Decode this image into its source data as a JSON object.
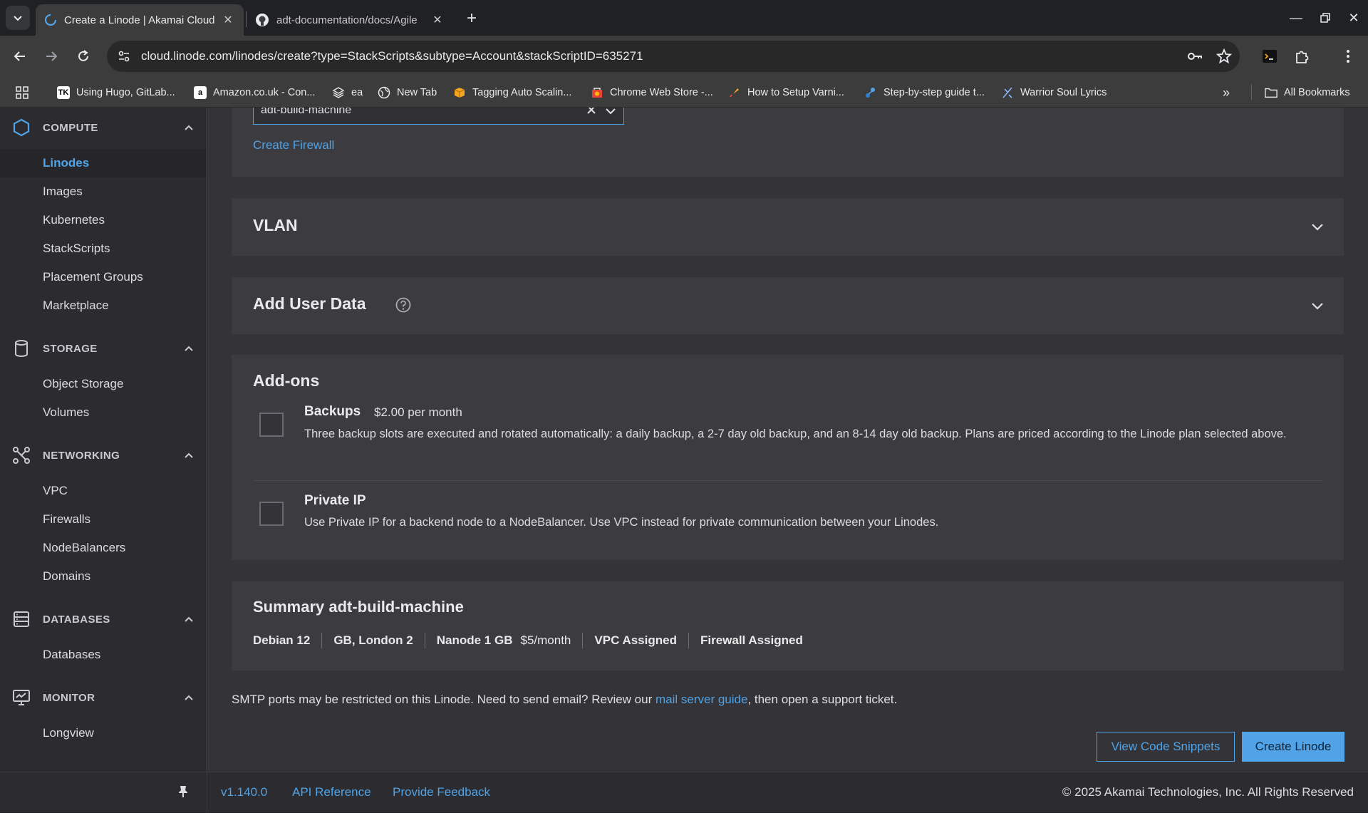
{
  "browser": {
    "tabs": [
      {
        "title": "Create a Linode | Akamai Cloud"
      },
      {
        "title": "adt-documentation/docs/Agile"
      }
    ],
    "url": "cloud.linode.com/linodes/create?type=StackScripts&subtype=Account&stackScriptID=635271",
    "bookmarks": [
      {
        "label": "Using Hugo, GitLab..."
      },
      {
        "label": "Amazon.co.uk - Con..."
      },
      {
        "label": "ea"
      },
      {
        "label": "New Tab"
      },
      {
        "label": "Tagging Auto Scalin..."
      },
      {
        "label": "Chrome Web Store -..."
      },
      {
        "label": "How to Setup Varni..."
      },
      {
        "label": "Step-by-step guide t..."
      },
      {
        "label": "Warrior Soul Lyrics"
      }
    ],
    "all_bookmarks": "All Bookmarks",
    "tk_badge": "TK",
    "amazon_badge": "a"
  },
  "sidebar": {
    "compute": {
      "label": "COMPUTE",
      "items": [
        "Linodes",
        "Images",
        "Kubernetes",
        "StackScripts",
        "Placement Groups",
        "Marketplace"
      ]
    },
    "storage": {
      "label": "STORAGE",
      "items": [
        "Object Storage",
        "Volumes"
      ]
    },
    "networking": {
      "label": "NETWORKING",
      "items": [
        "VPC",
        "Firewalls",
        "NodeBalancers",
        "Domains"
      ]
    },
    "databases": {
      "label": "DATABASES",
      "items": [
        "Databases"
      ]
    },
    "monitor": {
      "label": "MONITOR",
      "items": [
        "Longview"
      ]
    }
  },
  "firewall": {
    "selected": "adt-build-machine",
    "create_link": "Create Firewall"
  },
  "vlan": {
    "title": "VLAN"
  },
  "user_data": {
    "title": "Add User Data"
  },
  "addons": {
    "title": "Add-ons",
    "backups": {
      "title": "Backups",
      "price": "$2.00 per month",
      "description": "Three backup slots are executed and rotated automatically: a daily backup, a 2-7 day old backup, and an 8-14 day old backup. Plans are priced according to the Linode plan selected above.",
      "checked": false
    },
    "private_ip": {
      "title": "Private IP",
      "description": "Use Private IP for a backend node to a NodeBalancer. Use VPC instead for private communication between your Linodes.",
      "checked": false
    }
  },
  "summary": {
    "title": "Summary adt-build-machine",
    "image": "Debian 12",
    "region": "GB, London 2",
    "plan": "Nanode 1 GB",
    "price": "$5/month",
    "vpc": "VPC Assigned",
    "firewall": "Firewall Assigned"
  },
  "smtp_notice": {
    "before": "SMTP ports may be restricted on this Linode. Need to send email? Review our ",
    "link": "mail server guide",
    "after": ", then open a support ticket."
  },
  "actions": {
    "code_snippets": "View Code Snippets",
    "create": "Create Linode"
  },
  "footer": {
    "version": "v1.140.0",
    "api_reference": "API Reference",
    "feedback": "Provide Feedback",
    "copyright": "© 2025 Akamai Technologies, Inc. All Rights Reserved"
  },
  "colors": {
    "accent": "#4fa3e6",
    "sidebar_bg": "#2b2b30",
    "card_bg": "#3b3b40"
  }
}
